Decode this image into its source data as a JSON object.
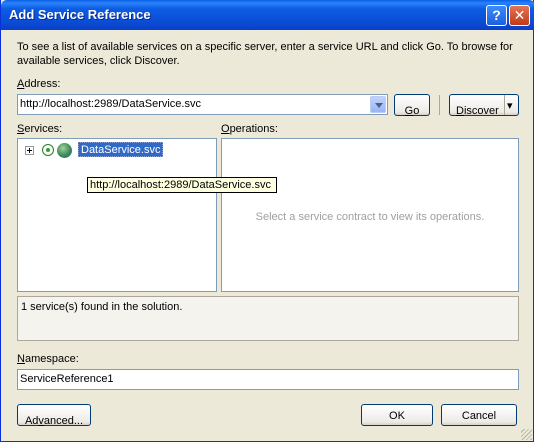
{
  "window": {
    "title": "Add Service Reference",
    "help": "?",
    "close": "✕"
  },
  "description": "To see a list of available services on a specific server, enter a service URL and click Go. To browse for available services, click Discover.",
  "address": {
    "label_first": "A",
    "label_rest": "ddress:",
    "value": "http://localhost:2989/DataService.svc",
    "go_first": "G",
    "go_rest": "o",
    "discover_first": "D",
    "discover_rest": "iscover",
    "discover_arrow": "▾"
  },
  "services": {
    "label_first": "S",
    "label_rest": "ervices:",
    "items": [
      {
        "name": "DataService.svc",
        "tooltip": "http://localhost:2989/DataService.svc"
      }
    ]
  },
  "operations": {
    "label_first": "O",
    "label_rest": "perations:",
    "placeholder": "Select a service contract to view its operations."
  },
  "status_text": "1 service(s) found in the solution.",
  "namespace": {
    "label_first": "N",
    "label_rest": "amespace:",
    "value": "ServiceReference1"
  },
  "buttons": {
    "advanced_pre": "Ad",
    "advanced_key": "v",
    "advanced_post": "anced...",
    "ok": "OK",
    "cancel": "Cancel"
  }
}
